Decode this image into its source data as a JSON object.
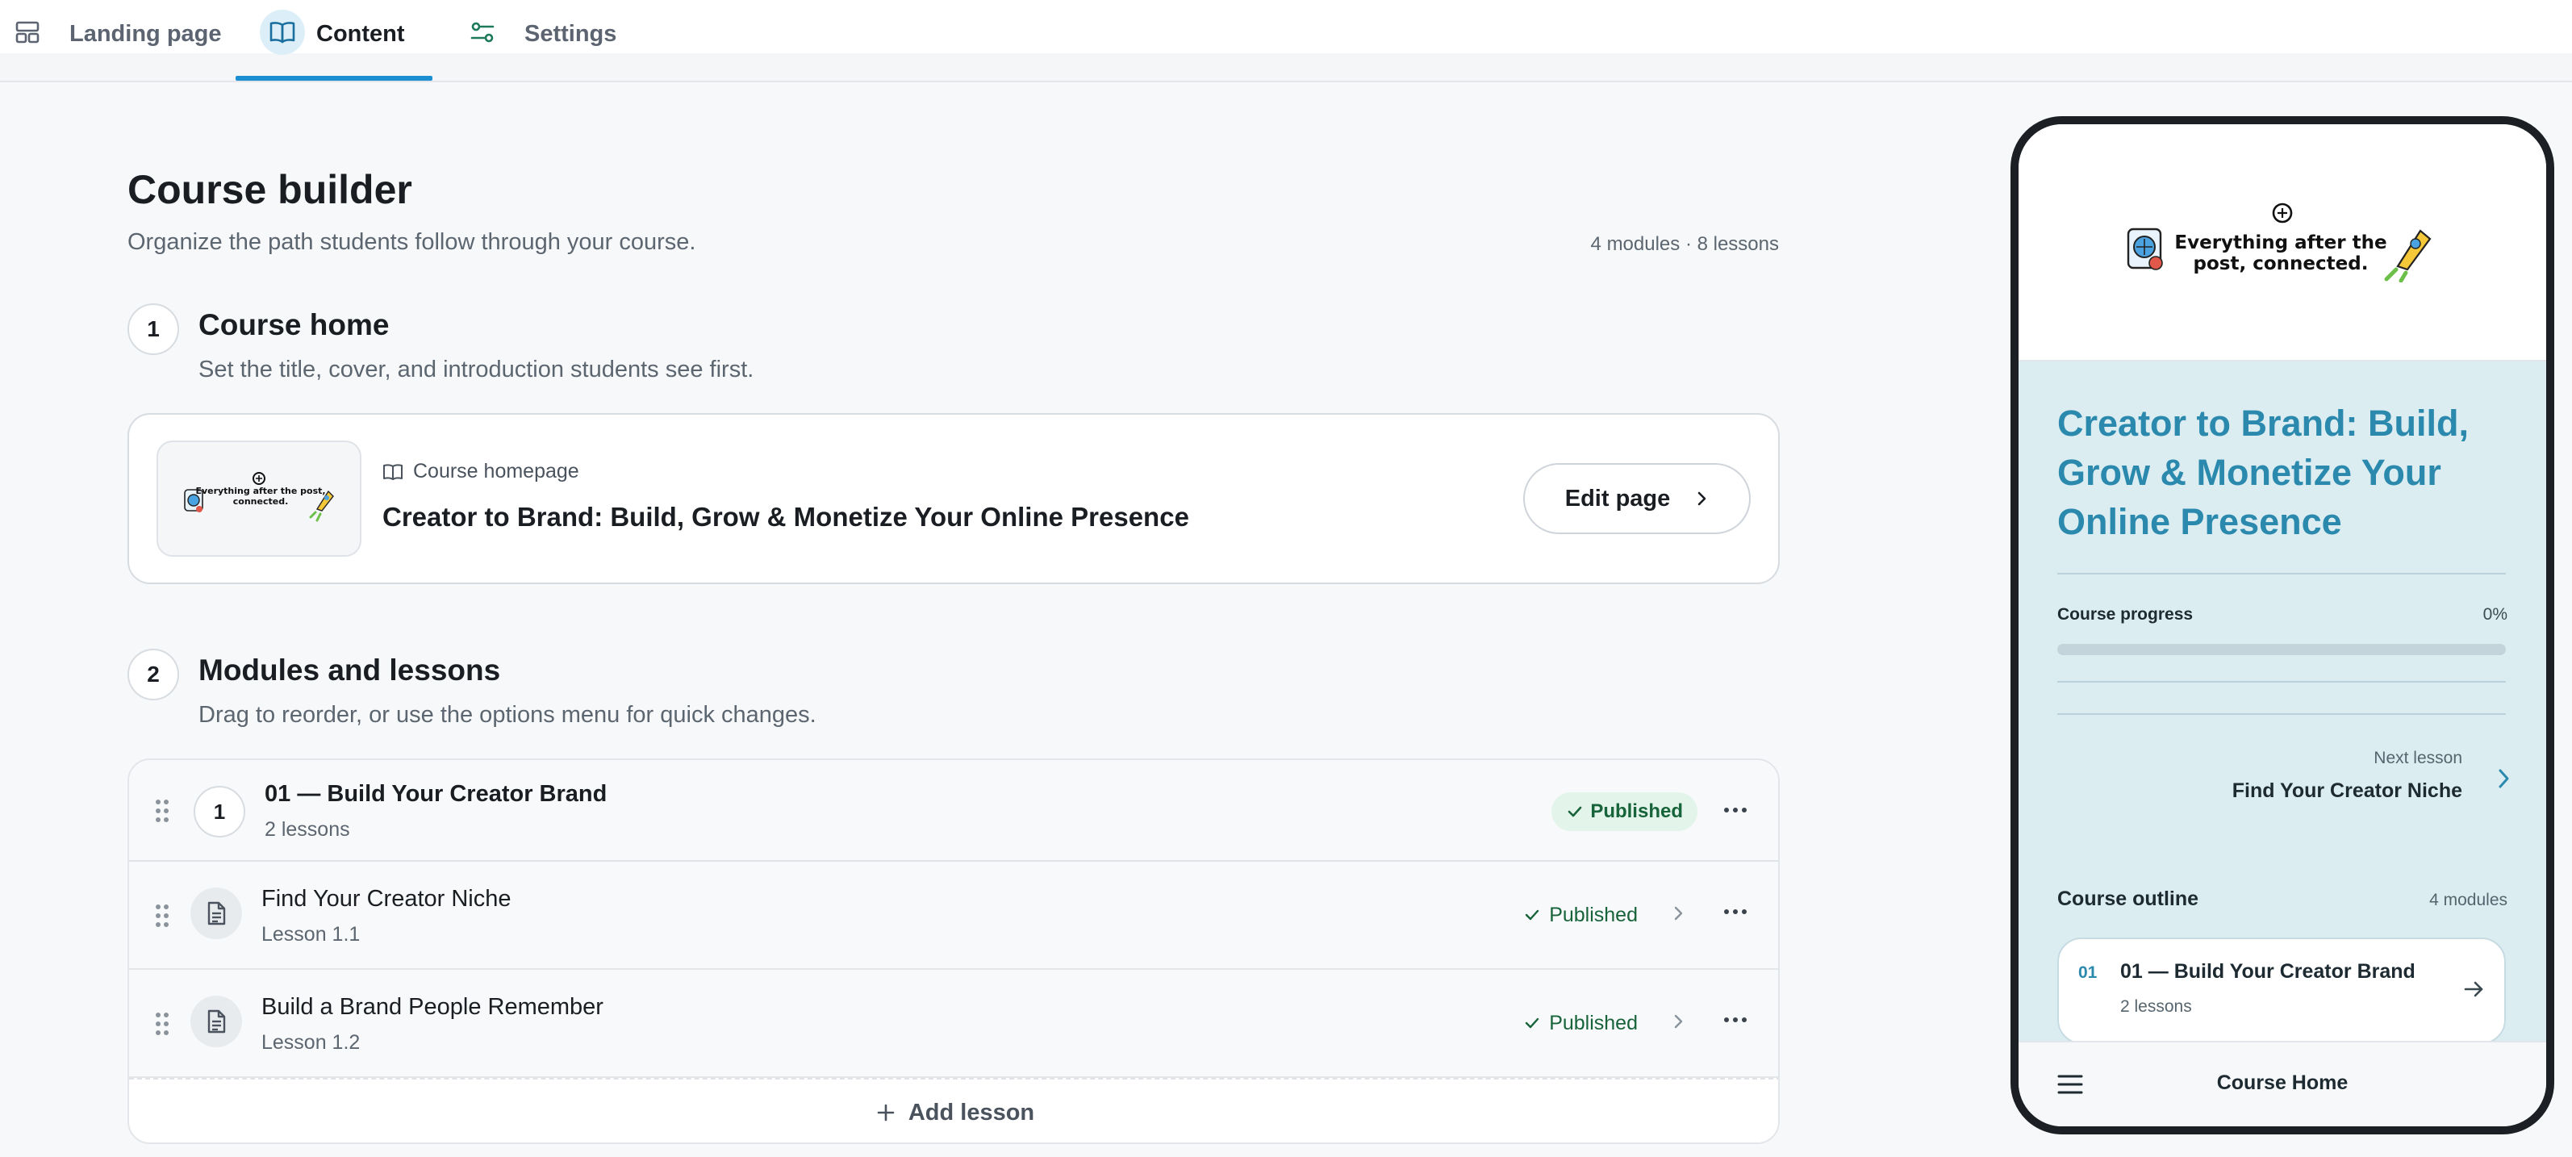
{
  "tabs": [
    {
      "label": "Landing page",
      "icon": "layout-icon"
    },
    {
      "label": "Content",
      "icon": "book-icon",
      "active": true
    },
    {
      "label": "Settings",
      "icon": "sliders-icon"
    }
  ],
  "header": {
    "title": "Course builder",
    "subtitle": "Organize the path students follow through your course.",
    "counts": "4 modules · 8 lessons"
  },
  "course_home": {
    "step": "1",
    "title": "Course home",
    "description": "Set the title, cover, and introduction students see first.",
    "card": {
      "meta_label": "Course homepage",
      "course_title": "Creator to Brand: Build, Grow & Monetize Your Online Presence",
      "edit_button": "Edit page",
      "logo_text": "Everything after the post, connected."
    }
  },
  "modules_section": {
    "step": "2",
    "title": "Modules and lessons",
    "description": "Drag to reorder, or use the options menu for quick changes.",
    "module": {
      "number": "1",
      "title": "01 — Build Your Creator Brand",
      "subtitle": "2 lessons",
      "status": "Published"
    },
    "lessons": [
      {
        "title": "Find Your Creator Niche",
        "subtitle": "Lesson 1.1",
        "status": "Published"
      },
      {
        "title": "Build a Brand People Remember",
        "subtitle": "Lesson 1.2",
        "status": "Published"
      }
    ],
    "add_lesson": "Add lesson"
  },
  "preview": {
    "logo_text": "Everything after the post, connected.",
    "course_title": "Creator to Brand: Build, Grow & Monetize Your Online Presence",
    "progress_label": "Course progress",
    "progress_value": "0%",
    "progress_fraction": 0,
    "next_lesson_label": "Next lesson",
    "next_lesson_title": "Find Your Creator Niche",
    "outline_title": "Course outline",
    "outline_count": "4 modules",
    "outline_module": {
      "number": "01",
      "title": "01 — Build Your Creator Brand",
      "subtitle": "2 lessons"
    },
    "footer_title": "Course Home"
  },
  "colors": {
    "accent": "#1b8fd1",
    "published": "#17633a",
    "preview_title": "#2a89ad",
    "preview_bg": "#dcedf2"
  }
}
